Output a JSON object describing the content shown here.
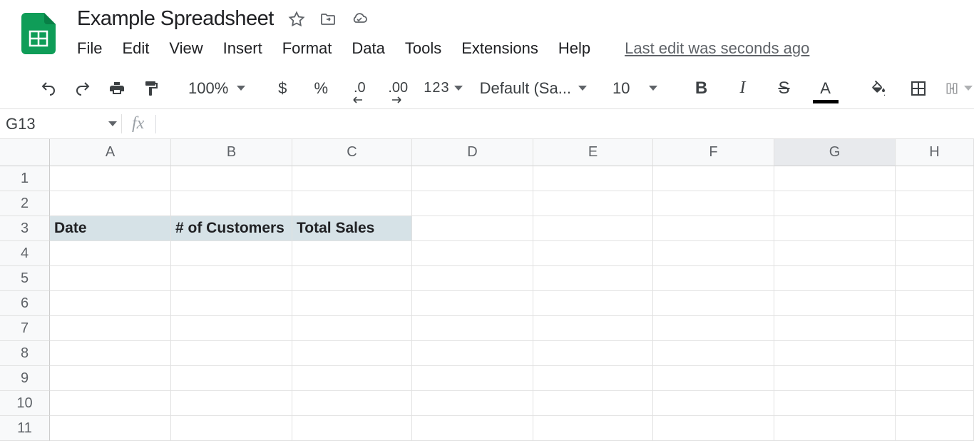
{
  "doc": {
    "title": "Example Spreadsheet"
  },
  "menu": {
    "file": "File",
    "edit": "Edit",
    "view": "View",
    "insert": "Insert",
    "format": "Format",
    "data": "Data",
    "tools": "Tools",
    "extensions": "Extensions",
    "help": "Help",
    "last_edit": "Last edit was seconds ago"
  },
  "toolbar": {
    "zoom": "100%",
    "currency": "$",
    "percent": "%",
    "dec_decrease": ".0",
    "dec_increase": ".00",
    "more_formats": "123",
    "font_name": "Default (Sa...",
    "font_size": "10",
    "bold": "B",
    "italic": "I",
    "strike": "S",
    "text_color": "A"
  },
  "name_box": {
    "value": "G13"
  },
  "fx": {
    "label": "fx"
  },
  "columns": [
    "A",
    "B",
    "C",
    "D",
    "E",
    "F",
    "G",
    "H"
  ],
  "rows": [
    "1",
    "2",
    "3",
    "4",
    "5",
    "6",
    "7",
    "8",
    "9",
    "10",
    "11"
  ],
  "selected_col_index": 6,
  "selected_row_index": null,
  "cells": {
    "r3": {
      "A": "Date",
      "B": "# of Customers",
      "C": "Total Sales"
    }
  }
}
